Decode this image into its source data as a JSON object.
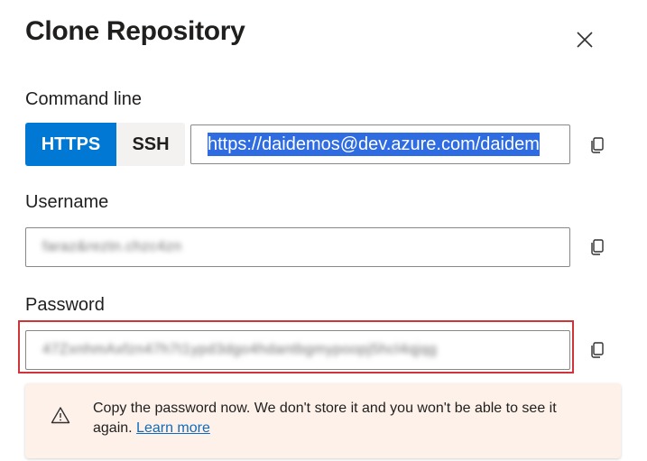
{
  "dialog": {
    "title": "Clone Repository",
    "close_icon": "close-icon"
  },
  "command_line": {
    "label": "Command line",
    "protocols": [
      {
        "label": "HTTPS",
        "selected": true
      },
      {
        "label": "SSH",
        "selected": false
      }
    ],
    "url_value": "https://daidemos@dev.azure.com/daidem",
    "copy_icon": "copy-icon"
  },
  "username": {
    "label": "Username",
    "value_obscured": "faraz&reztn.chzc4zn",
    "copy_icon": "copy-icon"
  },
  "password": {
    "label": "Password",
    "value_obscured": "47ZxnhmAxfzn47h7t1ypd3dgo4hdantbgmypoopj5hcl4qjqg",
    "copy_icon": "copy-icon"
  },
  "warning": {
    "icon": "warning-icon",
    "message": "Copy the password now. We don't store it and you won't be able to see it again.",
    "link_label": "Learn more"
  },
  "colors": {
    "accent": "#0078d4",
    "highlight_border": "#d13438",
    "warning_background": "#fdf1ea",
    "link": "#0f6cbd"
  }
}
